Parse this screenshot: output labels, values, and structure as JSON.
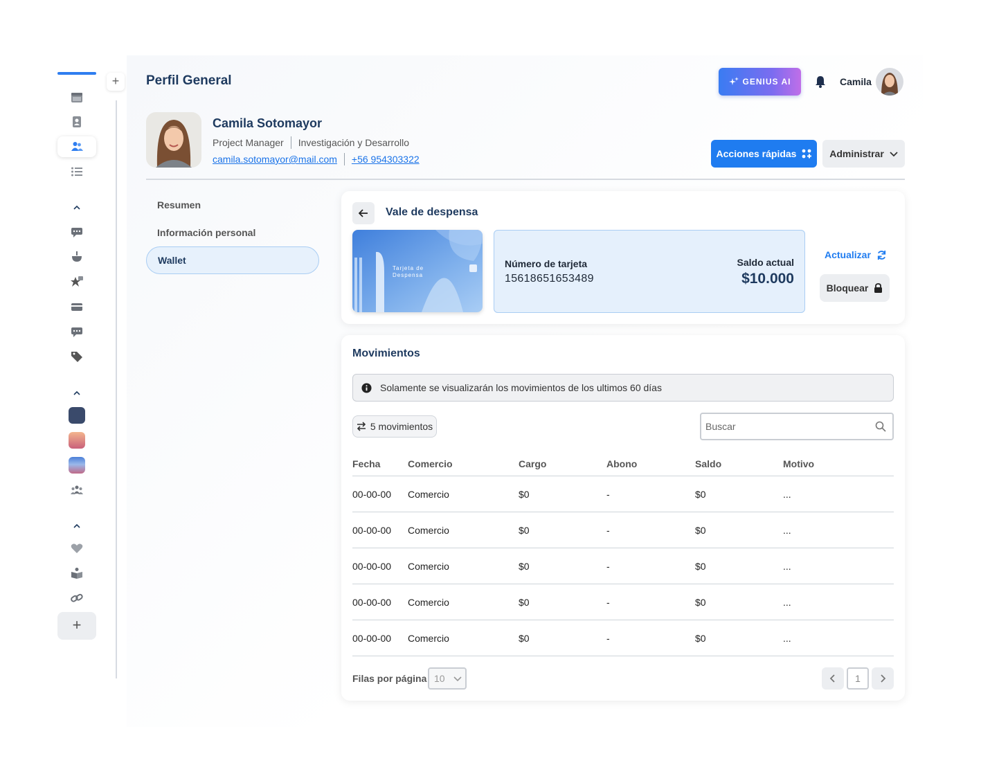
{
  "header": {
    "page_title": "Perfil General",
    "genius_label": "GENIUS AI",
    "user_name": "Camila"
  },
  "profile": {
    "name": "Camila Sotomayor",
    "role": "Project Manager",
    "department": "Investigación y Desarrollo",
    "email": "camila.sotomayor@mail.com",
    "phone": "+56 954303322",
    "quick_actions_label": "Acciones rápidas",
    "admin_label": "Administrar"
  },
  "nav": {
    "items": [
      {
        "label": "Resumen"
      },
      {
        "label": "Información personal"
      },
      {
        "label": "Wallet"
      }
    ],
    "active": "Wallet"
  },
  "vale": {
    "title": "Vale de despensa",
    "card_image_label": "Tarjeta de Despensa",
    "card_number_label": "Número de tarjeta",
    "card_number": "15618651653489",
    "balance_label": "Saldo actual",
    "balance": "$10.000",
    "refresh_label": "Actualizar",
    "block_label": "Bloquear"
  },
  "movements": {
    "title": "Movimientos",
    "info_text": "Solamente se visualizarán los movimientos de los ultimos 60 días",
    "count_label": "5 movimientos",
    "search_placeholder": "Buscar",
    "columns": [
      "Fecha",
      "Comercio",
      "Cargo",
      "Abono",
      "Saldo",
      "Motivo"
    ],
    "rows": [
      [
        "00-00-00",
        "Comercio",
        "$0",
        "-",
        "$0",
        "..."
      ],
      [
        "00-00-00",
        "Comercio",
        "$0",
        "-",
        "$0",
        "..."
      ],
      [
        "00-00-00",
        "Comercio",
        "$0",
        "-",
        "$0",
        "..."
      ],
      [
        "00-00-00",
        "Comercio",
        "$0",
        "-",
        "$0",
        "..."
      ],
      [
        "00-00-00",
        "Comercio",
        "$0",
        "-",
        "$0",
        "..."
      ]
    ],
    "rows_per_page_label": "Filas por página",
    "rows_per_page_value": "10",
    "current_page": "1"
  },
  "colors": {
    "primary": "#1f7cf0",
    "title": "#1e3a5f",
    "active_nav_bg": "#e7f1fc"
  }
}
